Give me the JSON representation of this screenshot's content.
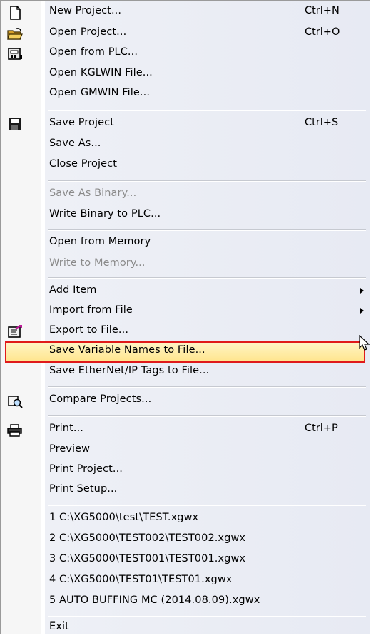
{
  "menu": {
    "new_project": {
      "label": "New Project...",
      "shortcut": "Ctrl+N",
      "icon": "new-document-icon"
    },
    "open_project": {
      "label": "Open Project...",
      "shortcut": "Ctrl+O",
      "icon": "open-folder-icon"
    },
    "open_from_plc": {
      "label": "Open from PLC...",
      "icon": "plc-open-icon"
    },
    "open_kglwin": {
      "label": "Open KGLWIN File..."
    },
    "open_gmwin": {
      "label": "Open GMWIN File..."
    },
    "save_project": {
      "label": "Save Project",
      "shortcut": "Ctrl+S",
      "icon": "floppy-disk-icon"
    },
    "save_as": {
      "label": "Save As..."
    },
    "close_project": {
      "label": "Close Project"
    },
    "save_as_binary": {
      "label": "Save As Binary...",
      "disabled": true
    },
    "write_binary": {
      "label": "Write Binary to PLC..."
    },
    "open_from_memory": {
      "label": "Open from Memory"
    },
    "write_to_memory": {
      "label": "Write to Memory...",
      "disabled": true
    },
    "add_item": {
      "label": "Add Item"
    },
    "import_from_file": {
      "label": "Import from File"
    },
    "export_to_file": {
      "label": "Export to File...",
      "icon": "export-icon"
    },
    "save_variable_names": {
      "label": "Save Variable Names to File...",
      "highlighted": true
    },
    "save_ethernet_tags": {
      "label": "Save EtherNet/IP Tags to File..."
    },
    "compare_projects": {
      "label": "Compare Projects...",
      "icon": "compare-icon"
    },
    "print": {
      "label": "Print...",
      "shortcut": "Ctrl+P",
      "icon": "printer-icon"
    },
    "preview": {
      "label": "Preview"
    },
    "print_project": {
      "label": "Print Project..."
    },
    "print_setup": {
      "label": "Print Setup..."
    },
    "recent_files": [
      {
        "label": "1 C:\\XG5000\\test\\TEST.xgwx"
      },
      {
        "label": "2 C:\\XG5000\\TEST002\\TEST002.xgwx"
      },
      {
        "label": "3 C:\\XG5000\\TEST001\\TEST001.xgwx"
      },
      {
        "label": "4 C:\\XG5000\\TEST01\\TEST01.xgwx"
      },
      {
        "label": "5 AUTO BUFFING MC (2014.08.09).xgwx"
      }
    ],
    "exit": {
      "label": "Exit"
    }
  },
  "colors": {
    "highlight_border": "#e01a1a",
    "highlight_fill": "#ffe48a",
    "disabled_text": "#8a8a8a"
  }
}
